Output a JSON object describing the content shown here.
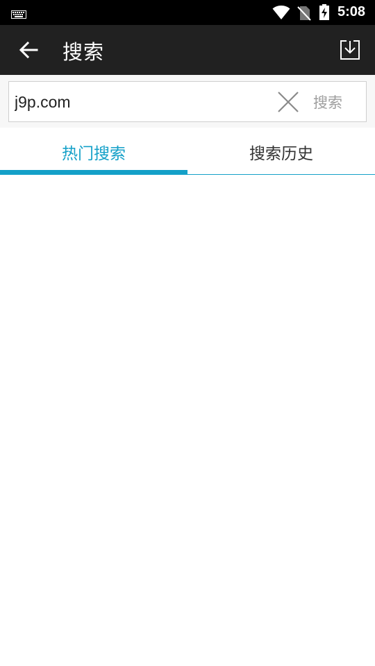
{
  "status_bar": {
    "time": "5:08",
    "icons": [
      "keyboard-icon",
      "wifi-icon",
      "no-sim-icon",
      "battery-charging-icon"
    ]
  },
  "app_bar": {
    "title": "搜索",
    "back_icon": "arrow-left-icon",
    "download_icon": "download-icon"
  },
  "search": {
    "value": "j9p.com",
    "placeholder": "",
    "clear_icon": "close-icon",
    "submit_label": "搜索"
  },
  "tabs": [
    {
      "label": "热门搜索",
      "active": true
    },
    {
      "label": "搜索历史",
      "active": false
    }
  ],
  "colors": {
    "accent": "#14a0c8",
    "app_bar": "#212121",
    "status_bar": "#000000"
  }
}
